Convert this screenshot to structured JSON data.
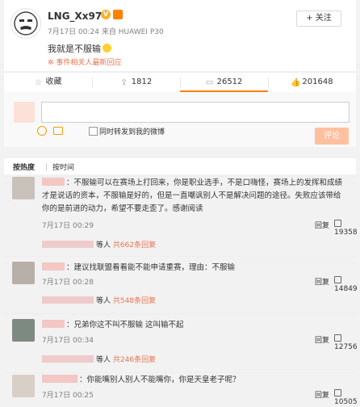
{
  "post": {
    "username": "LNG_Xx97",
    "verified_icon": "v-icon",
    "meta": "7月17日 00:24 来自 HUAWEI P30",
    "follow_label": "+ 关注",
    "text": "我就是不服输",
    "topic": "事件相关人最新回应"
  },
  "actions": {
    "favorite_label": "收藏",
    "share_count": "1812",
    "comment_count": "26512",
    "like_count": "201648"
  },
  "composer": {
    "share_label": "同时转发到我的微博",
    "submit_label": "评论"
  },
  "sort": {
    "hot": "按热度",
    "time": "按时间"
  },
  "comments": [
    {
      "text": "：不服输可以在赛场上打回来，你是职业选手，不是口嗨怪，赛场上的发挥和成绩才是说话的资本，不服输是好的，但是一直嘲讽别人不是解决问题的途径。失败应该带给你的是前进的动力，希望不要走歪了。感谢阅读",
      "time": "7月17日 00:29",
      "reply_label": "回复",
      "likes": "19358",
      "more_prefix": "等人",
      "more_count": "共662条回复"
    },
    {
      "text": "：建议找联盟看看能不能申请重赛，理由：不服输",
      "time": "7月17日 00:28",
      "reply_label": "回复",
      "likes": "14849",
      "more_prefix": "等人",
      "more_count": "共548条回复"
    },
    {
      "text": "：兄弟你这不叫不服输 这叫输不起",
      "time": "7月17日 00:34",
      "reply_label": "回复",
      "likes": "12756",
      "more_prefix": "等人",
      "more_count": "共246条回复"
    },
    {
      "text": "：你能嘴别人别人不能嘴你，你是天皇老子呢？",
      "time": "7月17日 00:25",
      "reply_label": "回复",
      "likes": "10505"
    }
  ],
  "colors": {
    "accent": "#ff8200",
    "link": "#eb7350"
  }
}
